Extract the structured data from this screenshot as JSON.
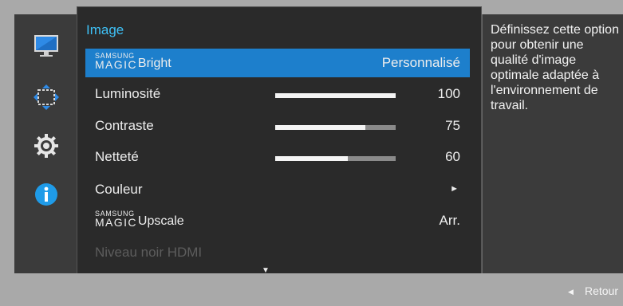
{
  "menu": {
    "title": "Image",
    "items": [
      {
        "brand_small": "SAMSUNG",
        "brand_big": "MAGIC",
        "label": "Bright",
        "value": "Personnalisé"
      },
      {
        "label": "Luminosité",
        "value": "100",
        "level": 1.0
      },
      {
        "label": "Contraste",
        "value": "75",
        "level": 0.75
      },
      {
        "label": "Netteté",
        "value": "60",
        "level": 0.6
      },
      {
        "label": "Couleur"
      },
      {
        "brand_small": "SAMSUNG",
        "brand_big": "MAGIC",
        "label": "Upscale",
        "value": "Arr."
      },
      {
        "label": "Niveau noir HDMI"
      }
    ]
  },
  "sidebar": {
    "icons": [
      "monitor-picture-icon",
      "screen-resize-icon",
      "settings-gear-icon",
      "information-icon"
    ]
  },
  "help": {
    "text": "Définissez cette option pour obtenir une qualité d'image optimale adaptée à l'environnement de travail."
  },
  "footer": {
    "return_label": "Retour"
  },
  "colors": {
    "accent": "#1d7fcc",
    "title": "#3ec0f5",
    "info": "#1f9be8"
  }
}
